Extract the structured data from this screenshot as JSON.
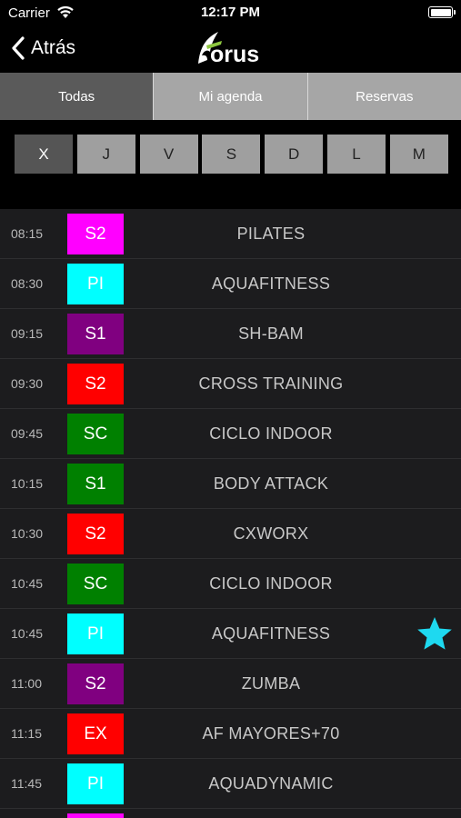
{
  "status_bar": {
    "carrier": "Carrier",
    "time": "12:17 PM"
  },
  "nav": {
    "back_label": "Atrás",
    "logo_text": "forus"
  },
  "segments": [
    {
      "label": "Todas",
      "active": true
    },
    {
      "label": "Mi agenda",
      "active": false
    },
    {
      "label": "Reservas",
      "active": false
    }
  ],
  "days": [
    {
      "label": "X",
      "active": true
    },
    {
      "label": "J",
      "active": false
    },
    {
      "label": "V",
      "active": false
    },
    {
      "label": "S",
      "active": false
    },
    {
      "label": "D",
      "active": false
    },
    {
      "label": "L",
      "active": false
    },
    {
      "label": "M",
      "active": false
    }
  ],
  "classes": [
    {
      "time": "08:15",
      "room": "S2",
      "color": "#ff00ff",
      "name": "PILATES",
      "favorite": false
    },
    {
      "time": "08:30",
      "room": "PI",
      "color": "#00ffff",
      "name": "AQUAFITNESS",
      "favorite": false
    },
    {
      "time": "09:15",
      "room": "S1",
      "color": "#800080",
      "name": "SH-BAM",
      "favorite": false
    },
    {
      "time": "09:30",
      "room": "S2",
      "color": "#ff0000",
      "name": "CROSS TRAINING",
      "favorite": false
    },
    {
      "time": "09:45",
      "room": "SC",
      "color": "#008000",
      "name": "CICLO INDOOR",
      "favorite": false
    },
    {
      "time": "10:15",
      "room": "S1",
      "color": "#008000",
      "name": "BODY ATTACK",
      "favorite": false
    },
    {
      "time": "10:30",
      "room": "S2",
      "color": "#ff0000",
      "name": "CXWORX",
      "favorite": false
    },
    {
      "time": "10:45",
      "room": "SC",
      "color": "#008000",
      "name": "CICLO INDOOR",
      "favorite": false
    },
    {
      "time": "10:45",
      "room": "PI",
      "color": "#00ffff",
      "name": "AQUAFITNESS",
      "favorite": true
    },
    {
      "time": "11:00",
      "room": "S2",
      "color": "#800080",
      "name": "ZUMBA",
      "favorite": false
    },
    {
      "time": "11:15",
      "room": "EX",
      "color": "#ff0000",
      "name": "AF MAYORES+70",
      "favorite": false
    },
    {
      "time": "11:45",
      "room": "PI",
      "color": "#00ffff",
      "name": "AQUADYNAMIC",
      "favorite": false
    },
    {
      "time": "",
      "room": "",
      "color": "#ff00ff",
      "name": "",
      "favorite": false
    }
  ],
  "colors": {
    "favorite_star": "#1ed9f0",
    "accent": "#ffffff"
  }
}
